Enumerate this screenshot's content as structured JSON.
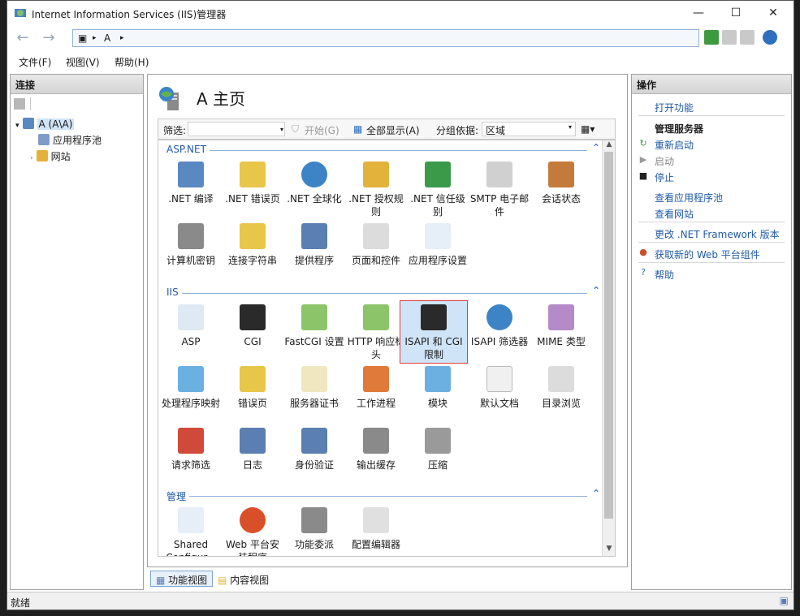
{
  "window": {
    "title": "Internet Information Services (IIS)管理器",
    "minimize": "—",
    "maximize": "☐",
    "close": "✕"
  },
  "address": {
    "path_root": "A",
    "separator": "▸"
  },
  "menu": {
    "file": "文件(F)",
    "view": "视图(V)",
    "help": "帮助(H)"
  },
  "connections": {
    "header": "连接",
    "tree": {
      "server": "A (A\\A)",
      "app_pools": "应用程序池",
      "sites": "网站"
    }
  },
  "main": {
    "title": "A 主页",
    "filter": {
      "label": "筛选:",
      "start": "开始(G)",
      "show_all": "全部显示(A)",
      "group_by_label": "分组依据:",
      "group_by_value": "区域"
    },
    "sections": [
      {
        "name": "ASP.NET",
        "items": [
          ".NET 编译",
          ".NET 错误页",
          ".NET 全球化",
          ".NET 授权规则",
          ".NET 信任级别",
          "SMTP 电子邮件",
          "会话状态",
          "计算机密钥",
          "连接字符串",
          "提供程序",
          "页面和控件",
          "应用程序设置"
        ]
      },
      {
        "name": "IIS",
        "items": [
          "ASP",
          "CGI",
          "FastCGI 设置",
          "HTTP 响应标头",
          "ISAPI 和 CGI 限制",
          "ISAPI 筛选器",
          "MIME 类型",
          "处理程序映射",
          "错误页",
          "服务器证书",
          "工作进程",
          "模块",
          "默认文档",
          "目录浏览",
          "请求筛选",
          "日志",
          "身份验证",
          "输出缓存",
          "压缩"
        ]
      },
      {
        "name": "管理",
        "items": [
          "Shared Configur...",
          "Web 平台安装程序",
          "功能委派",
          "配置编辑器"
        ]
      }
    ],
    "selected": "ISAPI 和 CGI 限制"
  },
  "view_tabs": {
    "features": "功能视图",
    "content": "内容视图"
  },
  "actions": {
    "header": "操作",
    "open_feature": "打开功能",
    "manage_server": "管理服务器",
    "restart": "重新启动",
    "start": "启动",
    "stop": "停止",
    "view_app_pools": "查看应用程序池",
    "view_sites": "查看网站",
    "change_net_version": "更改 .NET Framework 版本",
    "get_web_platform": "获取新的 Web 平台组件",
    "help": "帮助"
  },
  "status": {
    "text": "就绪"
  },
  "colors": {
    "link": "#1f5aa6",
    "selected_bg": "#cfe4f7",
    "selected_border": "#e23b3b",
    "header_bg": "#d4d4d4"
  }
}
